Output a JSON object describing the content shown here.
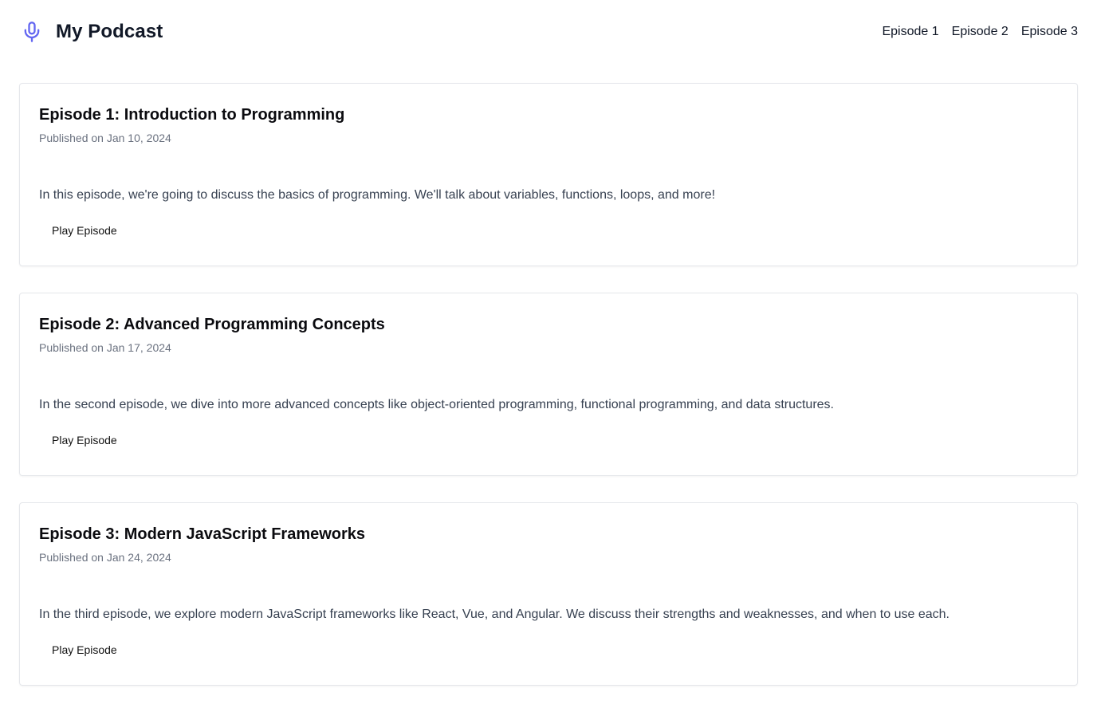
{
  "app": {
    "title": "My Podcast",
    "logo_icon": "microphone-icon",
    "accent_color": "#6366f1"
  },
  "nav": {
    "items": [
      {
        "label": "Episode 1"
      },
      {
        "label": "Episode 2"
      },
      {
        "label": "Episode 3"
      }
    ]
  },
  "episodes": [
    {
      "title": "Episode 1: Introduction to Programming",
      "date": "Published on Jan 10, 2024",
      "description": "In this episode, we're going to discuss the basics of programming. We'll talk about variables, functions, loops, and more!",
      "play_label": "Play Episode"
    },
    {
      "title": "Episode 2: Advanced Programming Concepts",
      "date": "Published on Jan 17, 2024",
      "description": "In the second episode, we dive into more advanced concepts like object-oriented programming, functional programming, and data structures.",
      "play_label": "Play Episode"
    },
    {
      "title": "Episode 3: Modern JavaScript Frameworks",
      "date": "Published on Jan 24, 2024",
      "description": "In the third episode, we explore modern JavaScript frameworks like React, Vue, and Angular. We discuss their strengths and weaknesses, and when to use each.",
      "play_label": "Play Episode"
    }
  ]
}
